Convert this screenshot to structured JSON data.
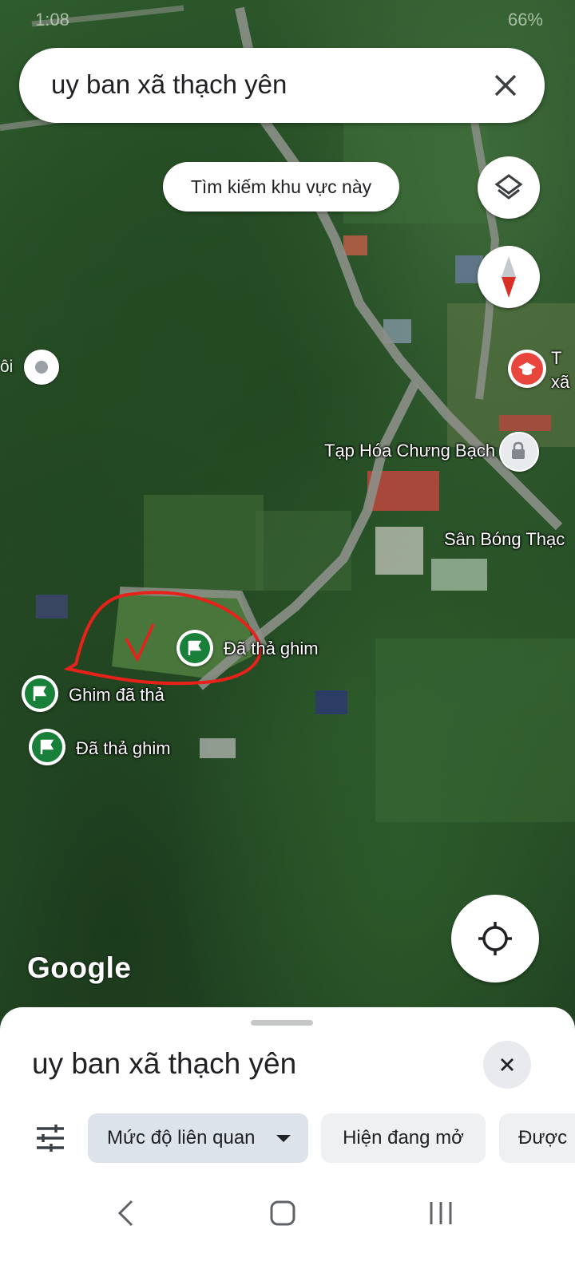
{
  "status_bar": {
    "time": "1:08",
    "battery": "66%"
  },
  "search": {
    "query": "uy ban xã thạch yên"
  },
  "map": {
    "search_area_button": "Tìm kiếm khu vực này",
    "my_location_partial": "ôi",
    "labels": {
      "shop": "Tạp Hóa Chưng Bạch",
      "stadium": "Sân Bóng Thạc",
      "school_partial_1": "T",
      "school_partial_2": "xã"
    },
    "pins": [
      {
        "label": "Đã thả ghim"
      },
      {
        "label": "Ghim đã thả"
      },
      {
        "label": "Đã thả ghim"
      }
    ],
    "attribution": "Google",
    "annotation_mark": "✓"
  },
  "bottom_sheet": {
    "title": "uy ban xã thạch yên",
    "chips": {
      "relevance": "Mức độ liên quan",
      "open_now": "Hiện đang mở",
      "third": "Được"
    }
  },
  "colors": {
    "pin_green": "#188038",
    "school_red": "#e8453c",
    "annotation_red": "#e8211b"
  }
}
